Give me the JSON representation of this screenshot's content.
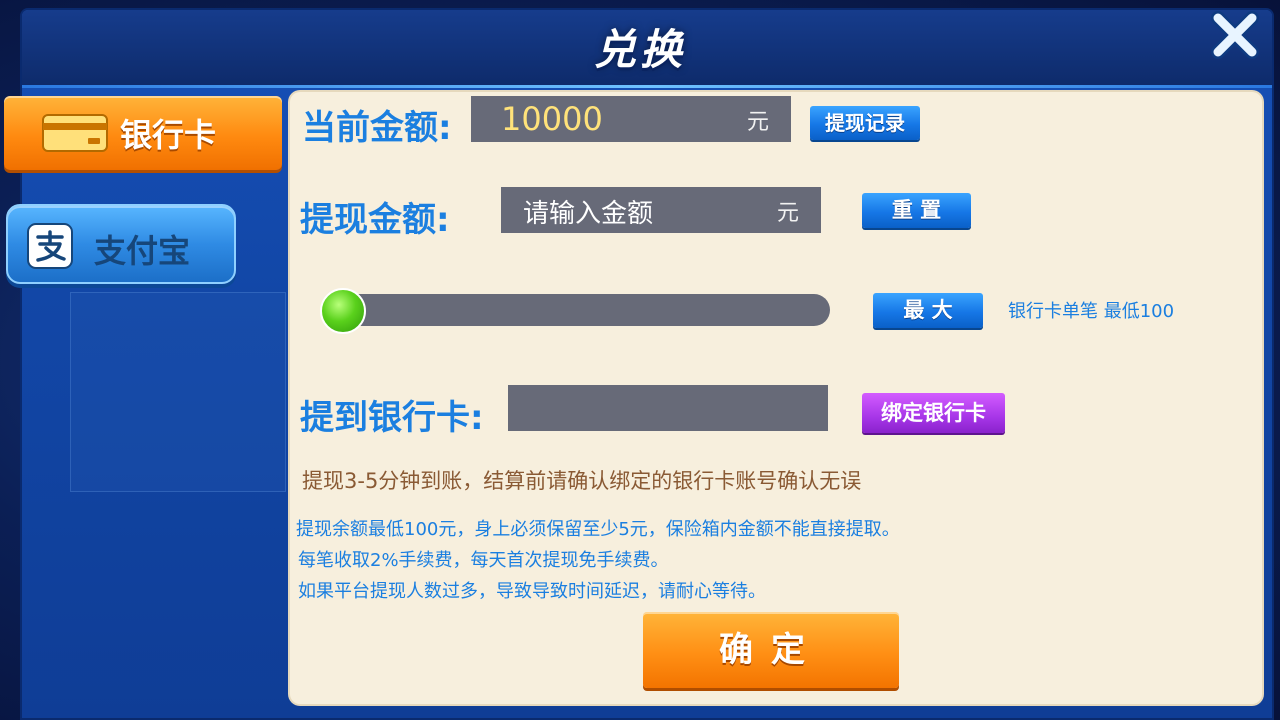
{
  "window": {
    "title": "兑换"
  },
  "icons": {
    "close": "close-icon",
    "bank_card": "bank-card-icon",
    "alipay": "alipay-icon"
  },
  "tabs": [
    {
      "label": "银行卡",
      "active": true
    },
    {
      "label": "支付宝",
      "active": false
    }
  ],
  "form": {
    "current_amount_label": "当前金额:",
    "current_amount_value": "10000",
    "currency_unit": "元",
    "history_button": "提现记录",
    "withdraw_amount_label": "提现金额:",
    "withdraw_amount_placeholder": "请输入金额",
    "reset_button": "重 置",
    "slider_level": 0,
    "max_button": "最 大",
    "min_hint": "银行卡单笔 最低100",
    "bank_card_label": "提到银行卡:",
    "bank_card_value": "",
    "bind_button": "绑定银行卡"
  },
  "notices": {
    "primary": "提现3-5分钟到账，结算前请确认绑定的银行卡账号确认无误",
    "lines": [
      "提现余额最低100元，身上必须保留至少5元，保险箱内金额不能直接提取。",
      "每笔收取2%手续费，每天首次提现免手续费。",
      "如果平台提现人数过多，导致导致时间延迟，请耐心等待。"
    ]
  },
  "confirm_button": "确定",
  "colors": {
    "accent_blue": "#1b7fe0",
    "orange": "#ff8a10",
    "panel_bg": "#f7efdd",
    "field_bg": "#676a78",
    "purple": "#a736e8",
    "green_knob": "#5ad11c"
  }
}
